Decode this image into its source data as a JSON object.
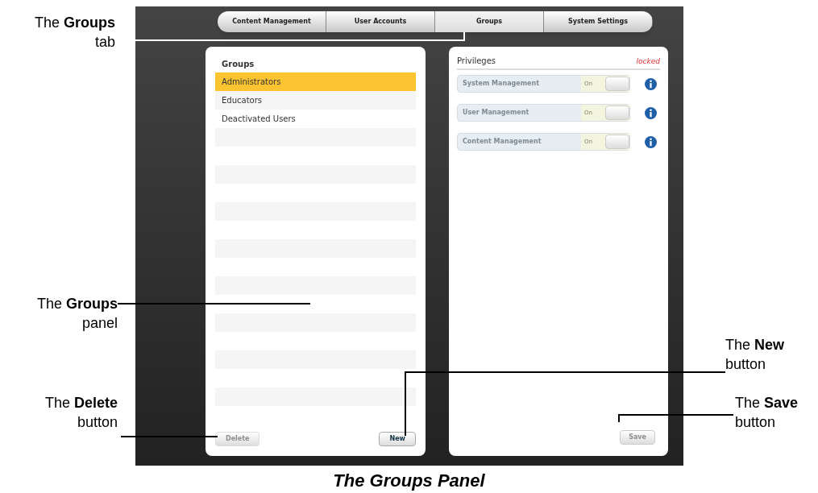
{
  "tabs": [
    {
      "label": "Content Management",
      "selected": false
    },
    {
      "label": "User Accounts",
      "selected": false
    },
    {
      "label": "Groups",
      "selected": true
    },
    {
      "label": "System Settings",
      "selected": false
    }
  ],
  "groups_panel": {
    "title": "Groups",
    "items": [
      {
        "label": "Administrators",
        "selected": true
      },
      {
        "label": "Educators",
        "selected": false
      },
      {
        "label": "Deactivated Users",
        "selected": false
      }
    ],
    "buttons": [
      {
        "label": "Delete",
        "disabled": true
      },
      {
        "label": "New",
        "disabled": false
      }
    ]
  },
  "privileges_panel": {
    "title": "Privileges",
    "status": "locked",
    "items": [
      {
        "label": "System Management",
        "toggle": "On",
        "disabled": true
      },
      {
        "label": "User Management",
        "toggle": "On",
        "disabled": true
      },
      {
        "label": "Content Management",
        "toggle": "On",
        "disabled": true
      }
    ],
    "save_button": {
      "label": "Save",
      "disabled": true
    }
  },
  "callouts": [
    {
      "text": "The **Groups** tab"
    },
    {
      "text": "The **Groups** panel"
    },
    {
      "text": "The **Delete** button"
    },
    {
      "text": "The **New** button"
    },
    {
      "text": "The **Save** button"
    }
  ],
  "caption": "The Groups Panel"
}
